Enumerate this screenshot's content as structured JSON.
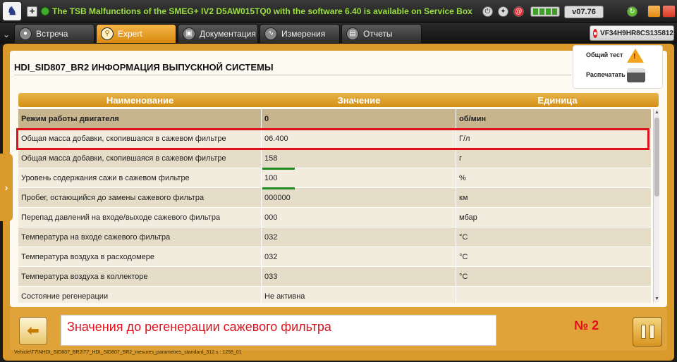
{
  "titlebar": {
    "notice": "The TSB Malfunctions of the SMEG+ IV2 D5AW015TQ0 with the software 6.40 is available on Service Box",
    "version": "v07.76",
    "logo_icon": "peugeot-lion-icon"
  },
  "tabs": [
    {
      "label": "Встреча",
      "icon": "meeting-icon"
    },
    {
      "label": "Expert",
      "icon": "expert-search-icon"
    },
    {
      "label": "Документация",
      "icon": "documentation-icon"
    },
    {
      "label": "Измерения",
      "icon": "measurement-icon"
    },
    {
      "label": "Отчеты",
      "icon": "reports-icon"
    }
  ],
  "vin": "VF34H9HR8CS135812",
  "page": {
    "title": "HDI_SID807_BR2  ИНФОРМАЦИЯ ВЫПУСКНОЙ СИСТЕМЫ",
    "actions": {
      "general_test": "Общий тест",
      "print": "Распечатать"
    }
  },
  "table": {
    "headers": [
      "Наименование",
      "Значение",
      "Единица"
    ],
    "rows": [
      [
        "Режим работы двигателя",
        "0",
        "об/мин"
      ],
      [
        "Общая масса добавки, скопившаяся в сажевом фильтре",
        "06.400",
        "Г/л"
      ],
      [
        "Общая масса добавки, скопившаяся в сажевом фильтре",
        "158",
        "г"
      ],
      [
        "Уровень содержания сажи в сажевом фильтре",
        "100",
        "%"
      ],
      [
        "Пробег, остающийся до замены сажевого фильтра",
        "000000",
        "км"
      ],
      [
        "Перепад давлений на входе/выходе сажевого фильтра",
        "000",
        "мбар"
      ],
      [
        "Температура на входе сажевого фильтра",
        "032",
        "°C"
      ],
      [
        "Температура воздуха в расходомере",
        "032",
        "°C"
      ],
      [
        "Температура воздуха в коллекторе",
        "033",
        "°C"
      ],
      [
        "Состояние регенерации",
        "Не активна",
        ""
      ]
    ]
  },
  "bottom": {
    "note": "Значения до регенерации сажевого фильтра",
    "note_number": "№ 2",
    "path": "Vehicle\\T7\\NHDI_SID807_BR2\\T7_HDI_SID807_BR2_mesures_parametres_standard_312.s : 1258_01"
  },
  "colors": {
    "accent": "#d99a2b",
    "highlight": "#e0101a",
    "underline": "#1f8a1f",
    "notice": "#9adf3f"
  }
}
